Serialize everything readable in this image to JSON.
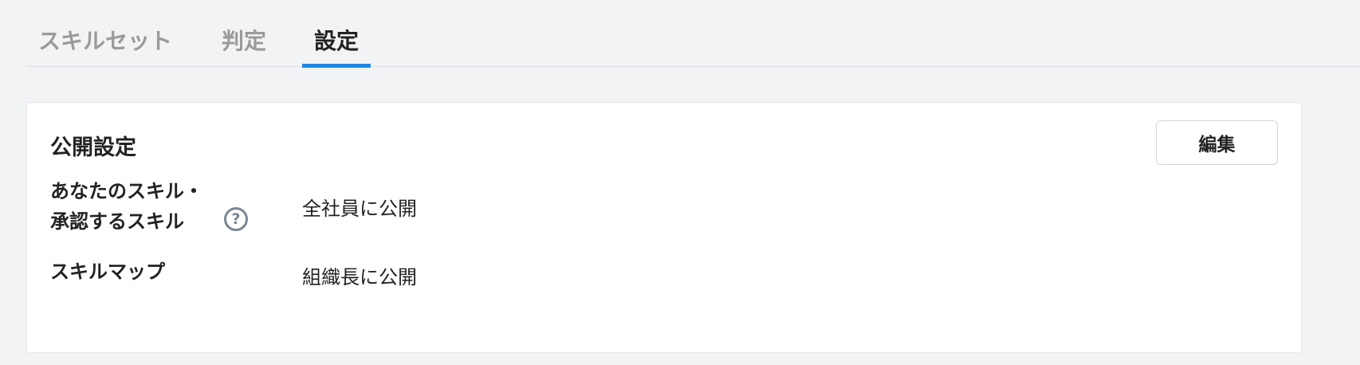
{
  "tabs": [
    {
      "label": "スキルセット",
      "active": false
    },
    {
      "label": "判定",
      "active": false
    },
    {
      "label": "設定",
      "active": true
    }
  ],
  "colors": {
    "accent": "#1e88e5",
    "background": "#f2f3f5",
    "help_icon": "#7a8696"
  },
  "card": {
    "title": "公開設定",
    "edit_label": "編集",
    "rows": [
      {
        "label_lines": [
          "あなたのスキル・",
          "承認するスキル"
        ],
        "help_icon": "question-circle-icon",
        "value": "全社員に公開"
      },
      {
        "label_lines": [
          "スキルマップ"
        ],
        "value": "組織長に公開"
      }
    ]
  }
}
